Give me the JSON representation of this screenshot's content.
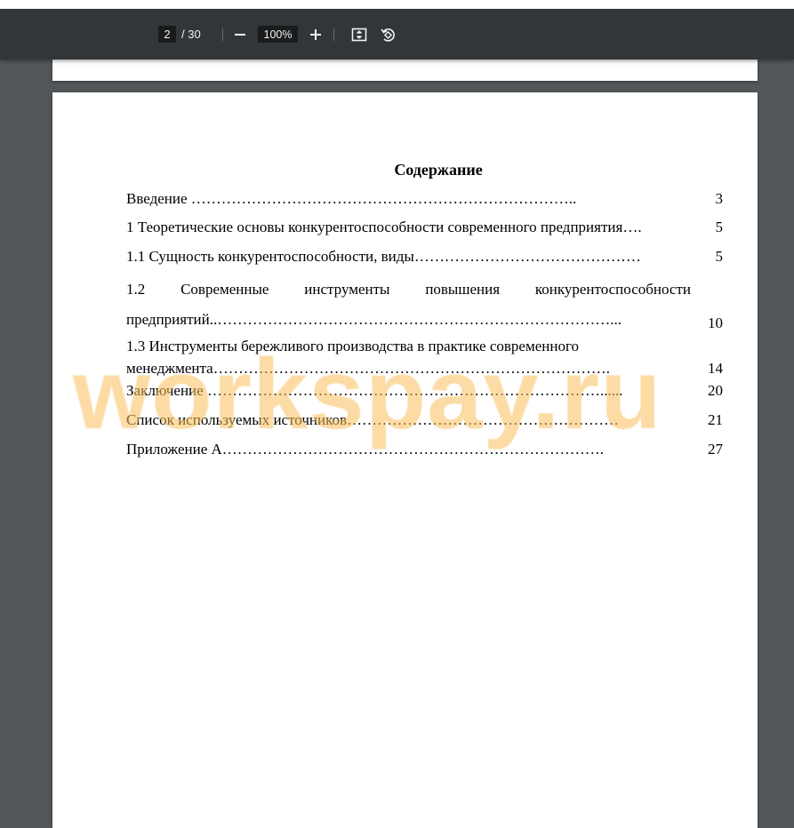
{
  "toolbar": {
    "current_page": "2",
    "total_pages": "/ 30",
    "zoom_out_icon": "minus-icon",
    "zoom_level": "100%",
    "zoom_in_icon": "plus-icon",
    "fit_icon": "fit-to-page-icon",
    "rotate_icon": "rotate-icon"
  },
  "document": {
    "title": "Содержание",
    "entries": [
      {
        "text": "Введение …………………………………………………………………..",
        "page": "3"
      },
      {
        "text": "1 Теоретические основы конкурентоспособности современного предприятия….",
        "page": "5"
      },
      {
        "text": "1.1 Сущность конкурентоспособности, виды………………………………………",
        "page": "5"
      },
      {
        "text_line1_words": [
          "1.2",
          "Современные",
          "инструменты",
          "повышения",
          "конкурентоспособности"
        ],
        "text_line2": "предприятий..……………………………………………………………………...",
        "page": "10"
      },
      {
        "text_line1": "1.3 Инструменты бережливого производства в практике современного",
        "text_line2": "менеджмента…………………………………………………………………….",
        "page": "14"
      },
      {
        "text": "Заключение ……………………………………………………………………......",
        "page": "20"
      },
      {
        "text": "Список используемых источников………………………………………………",
        "page": "21"
      },
      {
        "text": "Приложение А………………………………………………………………….",
        "page": "27"
      }
    ]
  },
  "watermark": "workspay.ru"
}
